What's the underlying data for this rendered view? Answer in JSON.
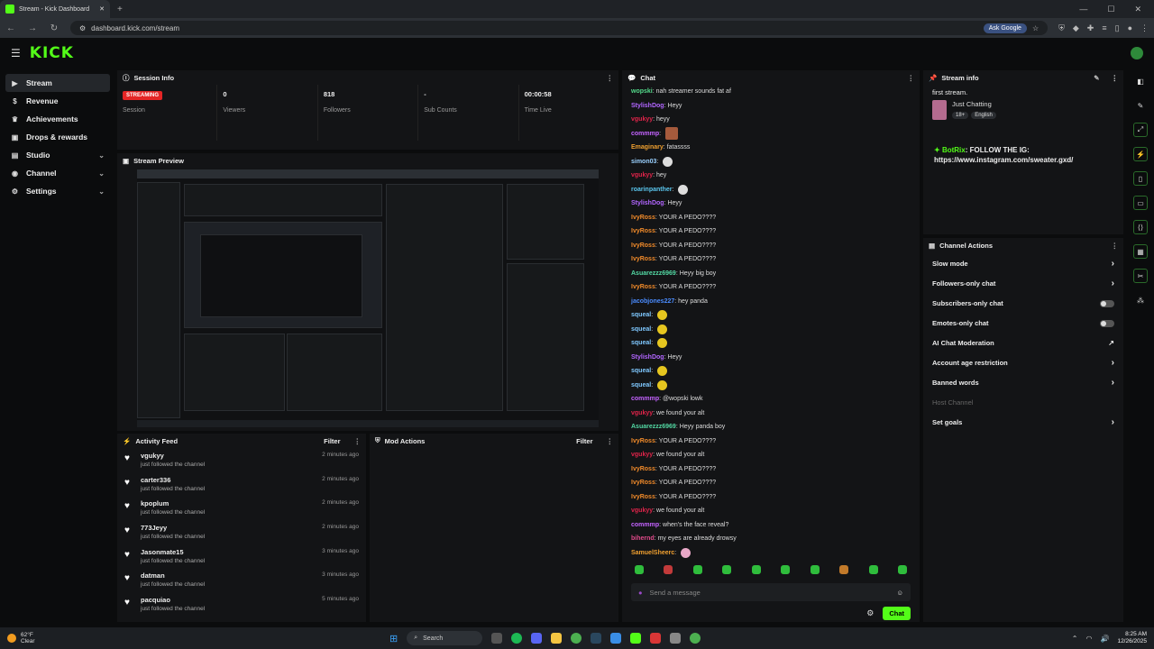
{
  "browser": {
    "tab_title": "Stream - Kick Dashboard",
    "new_tab": "+",
    "url": "dashboard.kick.com/stream",
    "ask_google": "Ask Google"
  },
  "header": {
    "logo": "KICK"
  },
  "sidebar": {
    "items": [
      {
        "label": "Stream",
        "icon": "video-icon"
      },
      {
        "label": "Revenue",
        "icon": "dollar-icon"
      },
      {
        "label": "Achievements",
        "icon": "trophy-icon"
      },
      {
        "label": "Drops & rewards",
        "icon": "gift-icon"
      },
      {
        "label": "Studio",
        "icon": "studio-icon"
      },
      {
        "label": "Channel",
        "icon": "channel-icon"
      },
      {
        "label": "Settings",
        "icon": "gear-icon"
      }
    ]
  },
  "session": {
    "title": "Session Info",
    "stats": [
      {
        "value": "STREAMING",
        "label": "Session"
      },
      {
        "value": "0",
        "label": "Viewers"
      },
      {
        "value": "818",
        "label": "Followers"
      },
      {
        "value": "-",
        "label": "Sub Counts"
      },
      {
        "value": "00:00:58",
        "label": "Time Live"
      }
    ]
  },
  "preview": {
    "title": "Stream Preview"
  },
  "activity": {
    "title": "Activity Feed",
    "filter": "Filter",
    "items": [
      {
        "name": "vgukyy",
        "action": "just followed the channel",
        "time": "2 minutes ago"
      },
      {
        "name": "carter336",
        "action": "just followed the channel",
        "time": "2 minutes ago"
      },
      {
        "name": "kpoplum",
        "action": "just followed the channel",
        "time": "2 minutes ago"
      },
      {
        "name": "773Jeyy",
        "action": "just followed the channel",
        "time": "2 minutes ago"
      },
      {
        "name": "Jasonmate15",
        "action": "just followed the channel",
        "time": "3 minutes ago"
      },
      {
        "name": "datman",
        "action": "just followed the channel",
        "time": "3 minutes ago"
      },
      {
        "name": "pacquiao",
        "action": "just followed the channel",
        "time": "5 minutes ago"
      }
    ]
  },
  "mod": {
    "title": "Mod Actions",
    "filter": "Filter"
  },
  "chat": {
    "title": "Chat",
    "placeholder": "Send a message",
    "send_label": "Chat",
    "messages": [
      {
        "user": "wopski",
        "color": "#53d98a",
        "text": "nah streamer sounds fat af"
      },
      {
        "user": "StylishDog",
        "color": "#b266ff",
        "text": "Heyy"
      },
      {
        "user": "vgukyy",
        "color": "#e0244a",
        "text": "heyy"
      },
      {
        "user": "commmp",
        "color": "#c463ff",
        "text": "",
        "emote": "img"
      },
      {
        "user": "Emaginary",
        "color": "#f0a030",
        "text": "fatassss"
      },
      {
        "user": "simon03",
        "color": "#9ad1ff",
        "text": "",
        "emote": "w"
      },
      {
        "user": "vgukyy",
        "color": "#e0244a",
        "text": "hey"
      },
      {
        "user": "roarinpanther",
        "color": "#5bc8f0",
        "text": "",
        "emote": "w"
      },
      {
        "user": "StylishDog",
        "color": "#b266ff",
        "text": "Heyy"
      },
      {
        "user": "IvyRoss",
        "color": "#f08a2a",
        "text": "YOUR A PEDO????"
      },
      {
        "user": "IvyRoss",
        "color": "#f08a2a",
        "text": "YOUR A PEDO????"
      },
      {
        "user": "IvyRoss",
        "color": "#f08a2a",
        "text": "YOUR A PEDO????"
      },
      {
        "user": "IvyRoss",
        "color": "#f08a2a",
        "text": "YOUR A PEDO????"
      },
      {
        "user": "Asuarezzz6969",
        "color": "#53d9a4",
        "text": "Heyy big boy"
      },
      {
        "user": "IvyRoss",
        "color": "#f08a2a",
        "text": "YOUR A PEDO????"
      },
      {
        "user": "jacobjones227",
        "color": "#4a8cff",
        "text": "hey panda"
      },
      {
        "user": "squeal",
        "color": "#7fc8ff",
        "text": "",
        "emote": "y"
      },
      {
        "user": "squeal",
        "color": "#7fc8ff",
        "text": "",
        "emote": "y"
      },
      {
        "user": "squeal",
        "color": "#7fc8ff",
        "text": "",
        "emote": "y"
      },
      {
        "user": "StylishDog",
        "color": "#b266ff",
        "text": "Heyy"
      },
      {
        "user": "squeal",
        "color": "#7fc8ff",
        "text": "",
        "emote": "y"
      },
      {
        "user": "squeal",
        "color": "#7fc8ff",
        "text": "",
        "emote": "y"
      },
      {
        "user": "commmp",
        "color": "#c463ff",
        "text": "@wopski lowk"
      },
      {
        "user": "vgukyy",
        "color": "#e0244a",
        "text": "we found your alt"
      },
      {
        "user": "Asuarezzz6969",
        "color": "#53d9a4",
        "text": "Heyy panda boy"
      },
      {
        "user": "IvyRoss",
        "color": "#f08a2a",
        "text": "YOUR A PEDO????"
      },
      {
        "user": "vgukyy",
        "color": "#e0244a",
        "text": "we found your alt"
      },
      {
        "user": "IvyRoss",
        "color": "#f08a2a",
        "text": "YOUR A PEDO????"
      },
      {
        "user": "IvyRoss",
        "color": "#f08a2a",
        "text": "YOUR A PEDO????"
      },
      {
        "user": "IvyRoss",
        "color": "#f08a2a",
        "text": "YOUR A PEDO????"
      },
      {
        "user": "vgukyy",
        "color": "#e0244a",
        "text": "we found your alt"
      },
      {
        "user": "commmp",
        "color": "#c463ff",
        "text": "when's the face reveal?"
      },
      {
        "user": "bihernd",
        "color": "#e04a8a",
        "text": "my eyes are already drowsy"
      },
      {
        "user": "SamuelSheerc",
        "color": "#f0a030",
        "text": "",
        "emote": "p"
      }
    ]
  },
  "stream_info": {
    "title": "Stream info",
    "stream_title": "first stream.",
    "category": "Just Chatting",
    "tags": [
      "18+",
      "English"
    ],
    "bot_name": "BotRix",
    "bot_message": "FOLLOW THE IG: https://www.instagram.com/sweater.gxd/"
  },
  "channel_actions": {
    "title": "Channel Actions",
    "items": [
      {
        "label": "Slow mode",
        "control": "arrow"
      },
      {
        "label": "Followers-only chat",
        "control": "arrow"
      },
      {
        "label": "Subscribers-only chat",
        "control": "toggle"
      },
      {
        "label": "Emotes-only chat",
        "control": "toggle"
      },
      {
        "label": "AI Chat Moderation",
        "control": "external"
      },
      {
        "label": "Account age restriction",
        "control": "arrow"
      },
      {
        "label": "Banned words",
        "control": "arrow"
      },
      {
        "label": "Host Channel",
        "control": "none"
      },
      {
        "label": "Set goals",
        "control": "arrow"
      }
    ]
  },
  "taskbar": {
    "temp": "62°F",
    "weather": "Clear",
    "search": "Search",
    "time": "8:25 AM",
    "date": "12/26/2025"
  },
  "colors": {
    "accent": "#53fc18",
    "streaming": "#e42525"
  }
}
